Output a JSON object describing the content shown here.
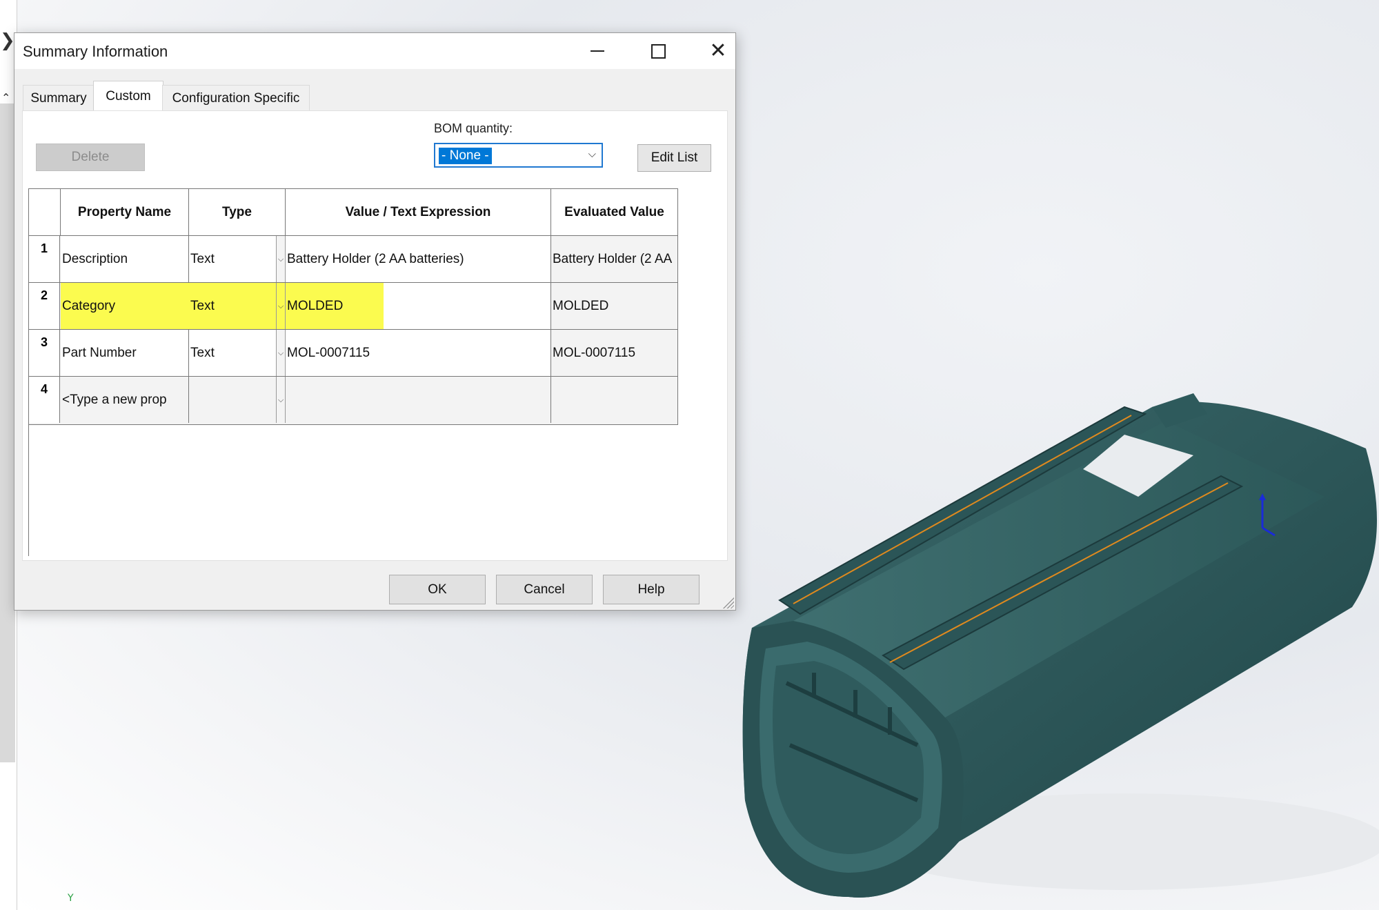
{
  "dialog": {
    "title": "Summary Information",
    "tabs": [
      "Summary",
      "Custom",
      "Configuration Specific"
    ],
    "active_tab": "Custom",
    "delete_label": "Delete",
    "bom_label": "BOM quantity:",
    "bom_value": "- None -",
    "edit_list_label": "Edit List",
    "ok_label": "OK",
    "cancel_label": "Cancel",
    "help_label": "Help"
  },
  "table": {
    "headers": [
      "Property Name",
      "Type",
      "Value / Text Expression",
      "Evaluated Value"
    ],
    "rows": [
      {
        "num": "1",
        "name": "Description",
        "type": "Text",
        "value": "Battery Holder (2 AA batteries)",
        "evaluated": "Battery Holder (2 AA"
      },
      {
        "num": "2",
        "name": "Category",
        "type": "Text",
        "value": "MOLDED",
        "evaluated": "MOLDED"
      },
      {
        "num": "3",
        "name": "Part Number",
        "type": "Text",
        "value": "MOL-0007115",
        "evaluated": "MOL-0007115"
      },
      {
        "num": "4",
        "name": "<Type a new prop",
        "type": "",
        "value": "",
        "evaluated": ""
      }
    ],
    "highlight_color": "#fbfb4f"
  },
  "viewport": {
    "triad_label": "Y",
    "model_color": "#2f5d5f",
    "edge_color": "#e08a1e"
  }
}
